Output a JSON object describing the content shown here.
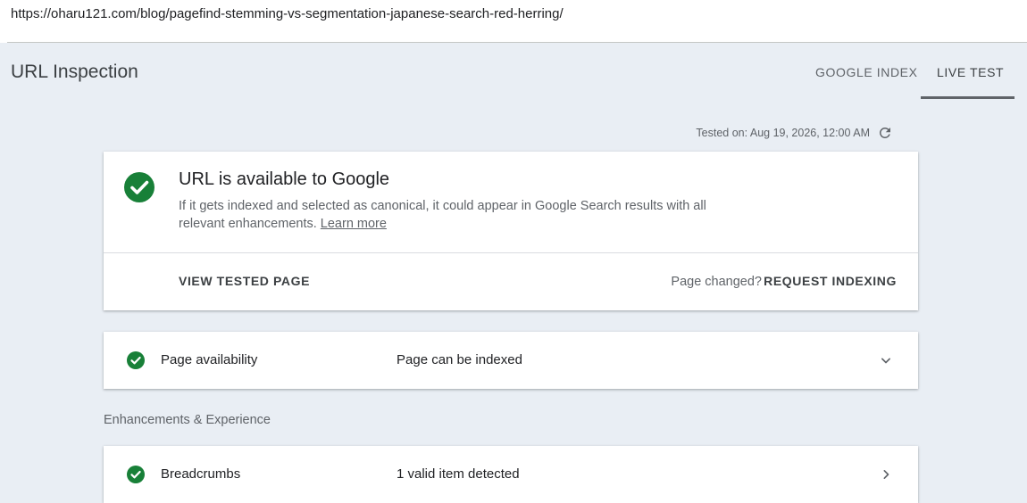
{
  "address_bar": {
    "url": "https://oharu121.com/blog/pagefind-stemming-vs-segmentation-japanese-search-red-herring/"
  },
  "header": {
    "title": "URL Inspection",
    "tabs": [
      {
        "label": "GOOGLE INDEX",
        "active": false
      },
      {
        "label": "LIVE TEST",
        "active": true
      }
    ]
  },
  "tested_on": "Tested on: Aug 19, 2026, 12:00 AM",
  "status_card": {
    "title": "URL is available to Google",
    "description": "If it gets indexed and selected as canonical, it could appear in Google Search results with all relevant enhancements.",
    "learn_more": "Learn more",
    "view_tested_page": "VIEW TESTED PAGE",
    "page_changed": "Page changed?",
    "request_indexing": "REQUEST INDEXING"
  },
  "availability": {
    "label": "Page availability",
    "value": "Page can be indexed"
  },
  "enhancements": {
    "section_title": "Enhancements & Experience",
    "items": [
      {
        "label": "Breadcrumbs",
        "value": "1 valid item detected"
      }
    ]
  },
  "colors": {
    "success": "#188038",
    "background": "#e9eef4"
  },
  "icons": {
    "status": "check-circle-icon",
    "refresh": "refresh-icon",
    "expand": "chevron-down-icon",
    "open": "chevron-right-icon"
  }
}
